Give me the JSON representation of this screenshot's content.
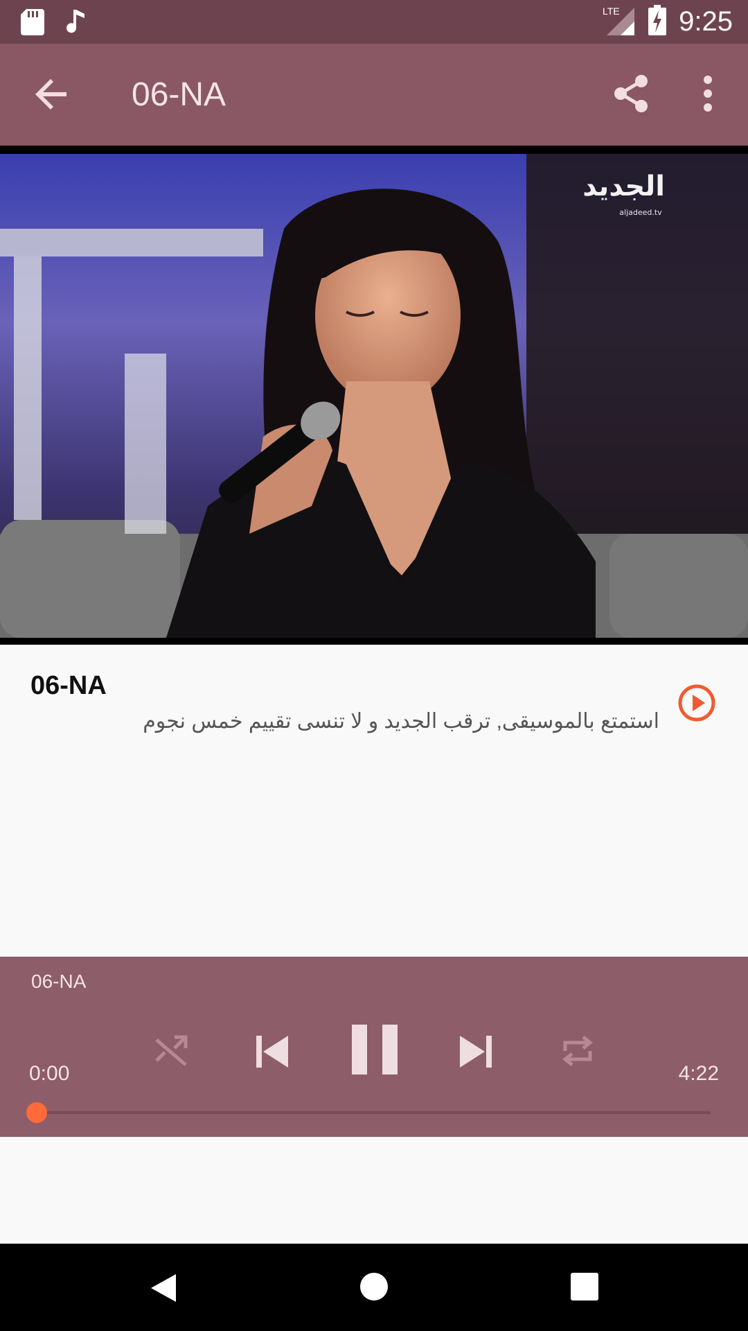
{
  "status_bar": {
    "time": "9:25",
    "network": "LTE",
    "icons": [
      "sd-card-icon",
      "music-note-icon",
      "signal-icon",
      "battery-charging-icon"
    ]
  },
  "app_bar": {
    "title": "06-NA",
    "icons": [
      "back-arrow-icon",
      "share-icon",
      "more-vert-icon"
    ]
  },
  "video": {
    "channel_logo": "الجديد",
    "channel_url": "aljadeed.tv"
  },
  "track": {
    "title": "06-NA",
    "description": "استمتع بالموسيقى, ترقب الجديد و لا تنسى تقييم خمس نجوم",
    "play_icon": "play-circle-icon"
  },
  "player": {
    "title": "06-NA",
    "time_current": "0:00",
    "time_total": "4:22",
    "progress": 0.0,
    "controls": [
      "shuffle-icon",
      "skip-previous-icon",
      "pause-icon",
      "skip-next-icon",
      "repeat-icon"
    ],
    "accent": "#ff6a3a"
  },
  "nav_bar": {
    "icons": [
      "nav-back-icon",
      "nav-home-icon",
      "nav-recents-icon"
    ]
  }
}
